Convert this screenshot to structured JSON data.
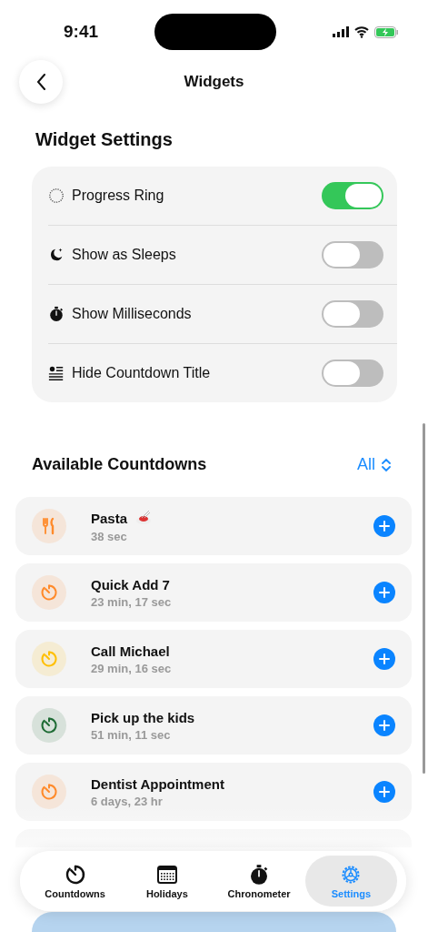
{
  "status_bar": {
    "time": "9:41"
  },
  "nav": {
    "title": "Widgets"
  },
  "widget_settings": {
    "title": "Widget Settings",
    "items": [
      {
        "label": "Progress Ring",
        "on": true
      },
      {
        "label": "Show as Sleeps",
        "on": false
      },
      {
        "label": "Show Milliseconds",
        "on": false
      },
      {
        "label": "Hide Countdown Title",
        "on": false
      }
    ]
  },
  "available": {
    "title": "Available Countdowns",
    "filter": "All",
    "items": [
      {
        "color": "#ff8a2a",
        "title": "Pasta",
        "subtitle": "38 sec"
      },
      {
        "color": "#ff8a2a",
        "title": "Quick Add 7",
        "subtitle": "23 min, 17 sec"
      },
      {
        "color": "#ffbf00",
        "title": "Call Michael",
        "subtitle": "29 min, 16 sec"
      },
      {
        "color": "#1e6b34",
        "title": "Pick up the kids",
        "subtitle": "51 min, 11 sec"
      },
      {
        "color": "#ff8a2a",
        "title": "Dentist Appointment",
        "subtitle": "6 days, 23 hr"
      }
    ]
  },
  "tabs": [
    {
      "label": "Countdowns",
      "selected": false
    },
    {
      "label": "Holidays",
      "selected": false
    },
    {
      "label": "Chronometer",
      "selected": false
    },
    {
      "label": "Settings",
      "selected": true
    }
  ]
}
